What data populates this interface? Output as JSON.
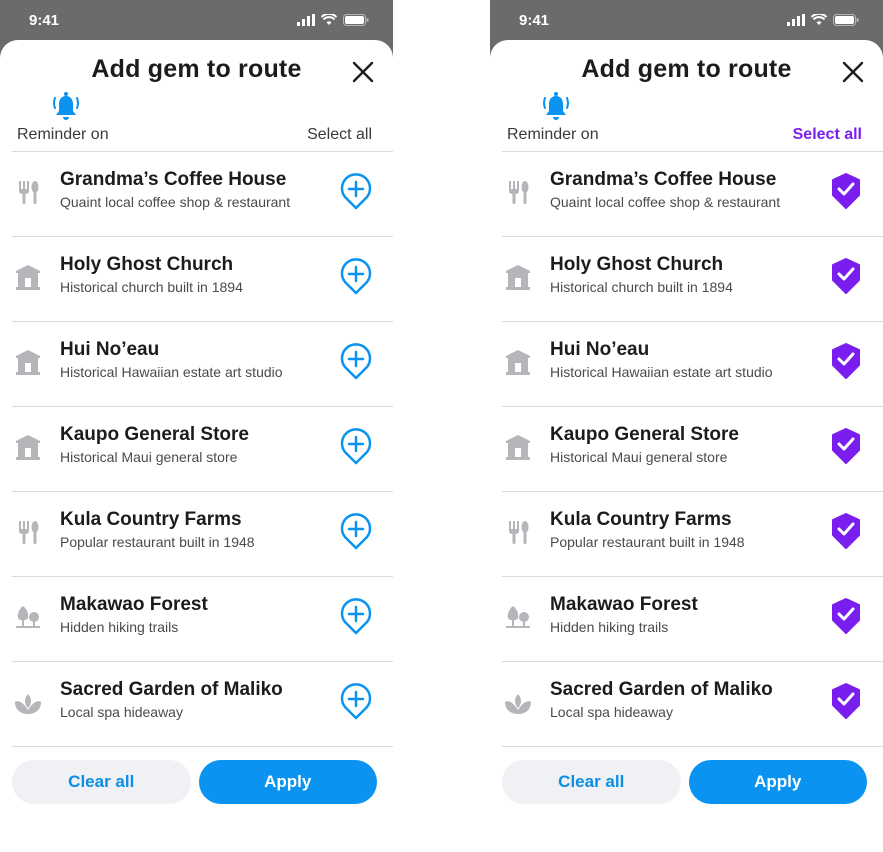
{
  "status_bar": {
    "time": "9:41"
  },
  "sheet": {
    "title": "Add gem to route",
    "reminder_label": "Reminder on",
    "select_all_label": "Select all",
    "clear_all_label": "Clear all",
    "apply_label": "Apply"
  },
  "colors": {
    "accent_blue": "#0a93f0",
    "accent_purple": "#7a1ef0",
    "icon_gray": "#b5b5ba"
  },
  "items": [
    {
      "name": "Grandma’s Coffee House",
      "desc": "Quaint local coffee shop & restaurant",
      "category_icon": "restaurant-icon"
    },
    {
      "name": "Holy Ghost Church",
      "desc": "Historical church built in 1894",
      "category_icon": "landmark-icon"
    },
    {
      "name": "Hui No’eau",
      "desc": "Historical Hawaiian estate art studio",
      "category_icon": "landmark-icon"
    },
    {
      "name": "Kaupo General Store",
      "desc": "Historical Maui general store",
      "category_icon": "landmark-icon"
    },
    {
      "name": "Kula Country Farms",
      "desc": "Popular restaurant built in 1948",
      "category_icon": "restaurant-icon"
    },
    {
      "name": "Makawao Forest",
      "desc": "Hidden hiking trails",
      "category_icon": "forest-icon"
    },
    {
      "name": "Sacred Garden of Maliko",
      "desc": "Local spa hideaway",
      "category_icon": "spa-icon"
    }
  ],
  "screens": [
    {
      "select_all_active": false,
      "action_icon": "add-pin-icon",
      "selected_count": 0
    },
    {
      "select_all_active": true,
      "action_icon": "check-pin-icon",
      "selected_count": 7
    }
  ]
}
